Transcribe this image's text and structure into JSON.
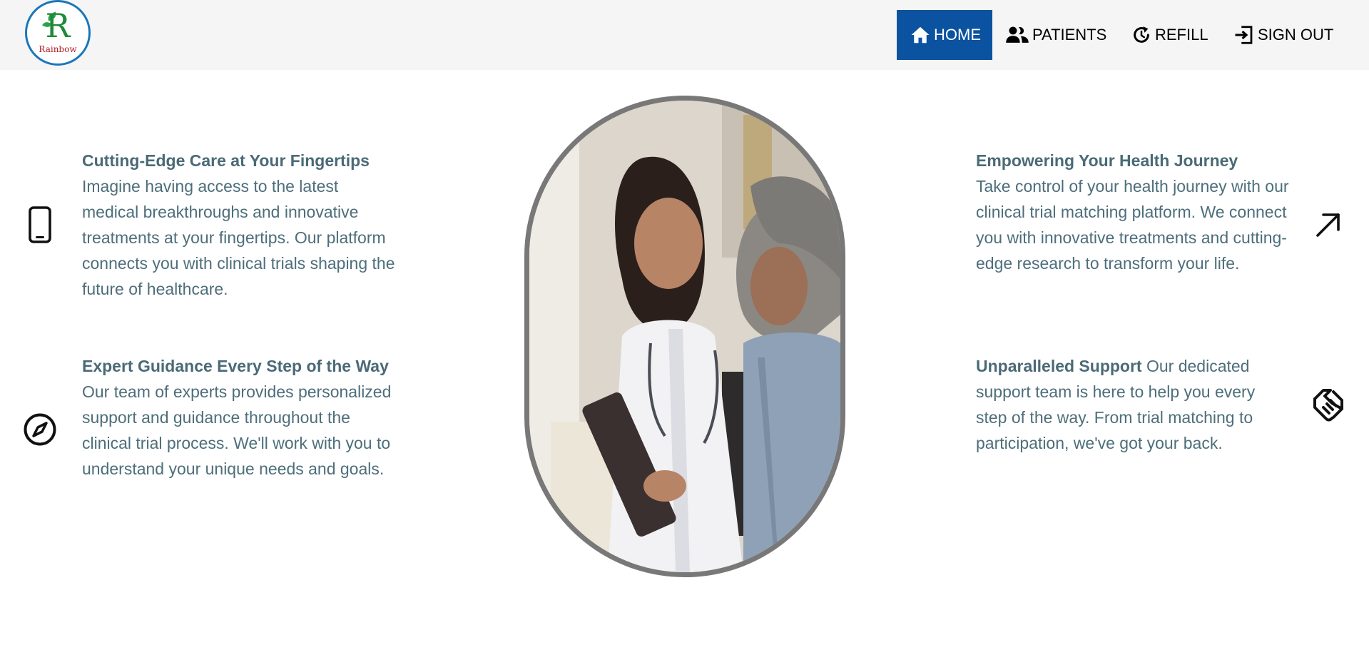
{
  "brand": {
    "logo_letter": "R",
    "logo_text": "Rainbow"
  },
  "nav": {
    "items": [
      {
        "label": "HOME",
        "icon": "home-icon",
        "active": true
      },
      {
        "label": "PATIENTS",
        "icon": "people-icon",
        "active": false
      },
      {
        "label": "REFILL",
        "icon": "refresh-icon",
        "active": false
      },
      {
        "label": "SIGN OUT",
        "icon": "sign-out-icon",
        "active": false
      }
    ]
  },
  "features": [
    {
      "icon": "phone-icon",
      "title": "Cutting-Edge Care at Your Fingertips",
      "body": "Imagine having access to the latest medical breakthroughs and innovative treatments at your fingertips. Our platform connects you with clinical trials shaping the future of healthcare."
    },
    {
      "icon": "compass-icon",
      "title": "Expert Guidance Every Step of the Way",
      "body": "Our team of experts provides personalized support and guidance throughout the clinical trial process. We'll work with you to understand your unique needs and goals."
    },
    {
      "icon": "arrow-up-right-icon",
      "title": "Empowering Your Health Journey",
      "body": "Take control of your health journey with our clinical trial matching platform. We connect you with innovative treatments and cutting-edge research to transform your life."
    },
    {
      "icon": "handshake-icon",
      "title": "Unparalleled Support",
      "body": "Our dedicated support team is here to help you every step of the way. From trial matching to participation, we've got your back."
    }
  ],
  "colors": {
    "nav_background": "#f5f5f5",
    "active_nav": "#0b52a0",
    "feature_text": "#4d6e7a",
    "portrait_border": "#787878"
  }
}
